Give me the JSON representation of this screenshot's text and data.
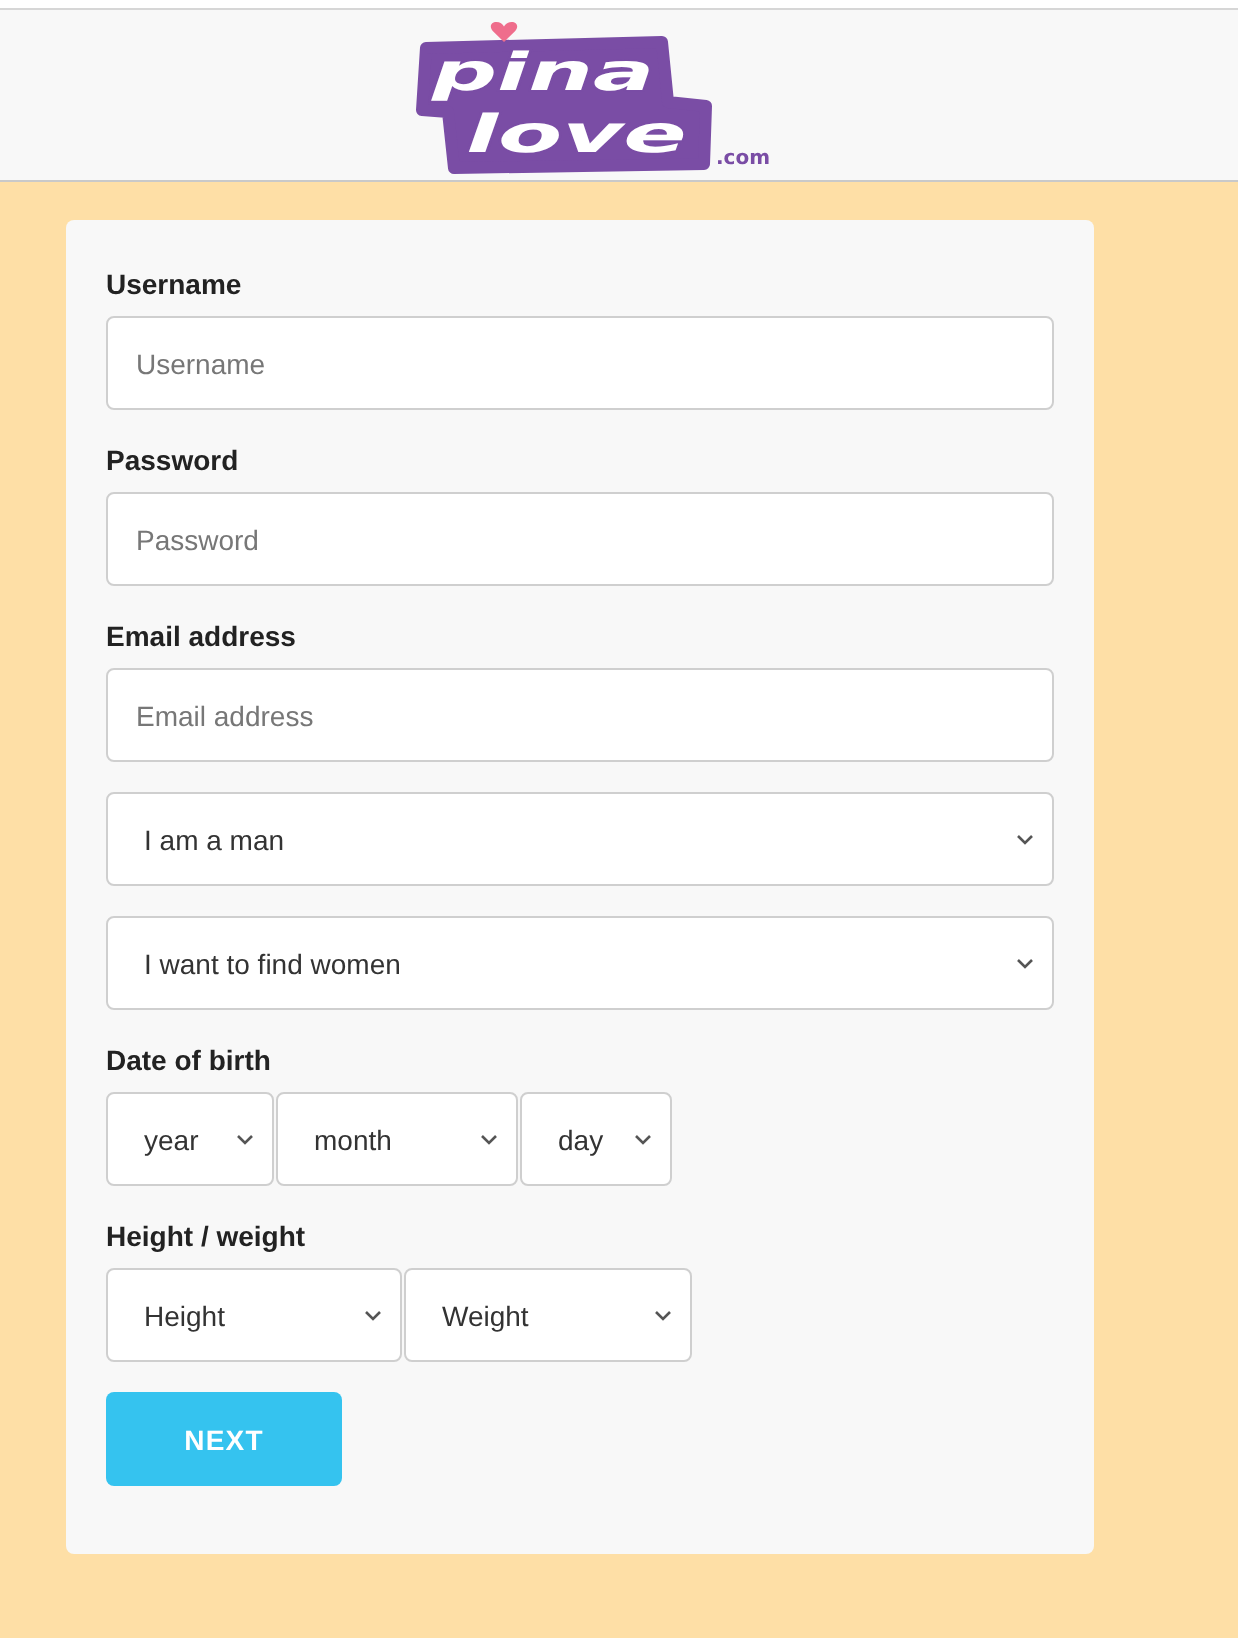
{
  "header": {
    "logo": {
      "top_word": "pina",
      "bottom_word": "love",
      "suffix": ".com"
    }
  },
  "form": {
    "fields": [
      {
        "kind": "text",
        "label": "Username",
        "placeholder": "Username"
      },
      {
        "kind": "password",
        "label": "Password",
        "placeholder": "Password"
      },
      {
        "kind": "text",
        "label": "Email address",
        "placeholder": "Email address"
      },
      {
        "kind": "select",
        "value": "I am a man"
      },
      {
        "kind": "select",
        "value": "I want to find women"
      },
      {
        "kind": "select_group",
        "label": "Date of birth",
        "selects": [
          {
            "value": "year"
          },
          {
            "value": "month"
          },
          {
            "value": "day"
          }
        ]
      },
      {
        "kind": "select_group",
        "label": "Height / weight",
        "selects": [
          {
            "value": "Height"
          },
          {
            "value": "Weight"
          }
        ]
      }
    ],
    "submit": {
      "label": "NEXT"
    }
  }
}
